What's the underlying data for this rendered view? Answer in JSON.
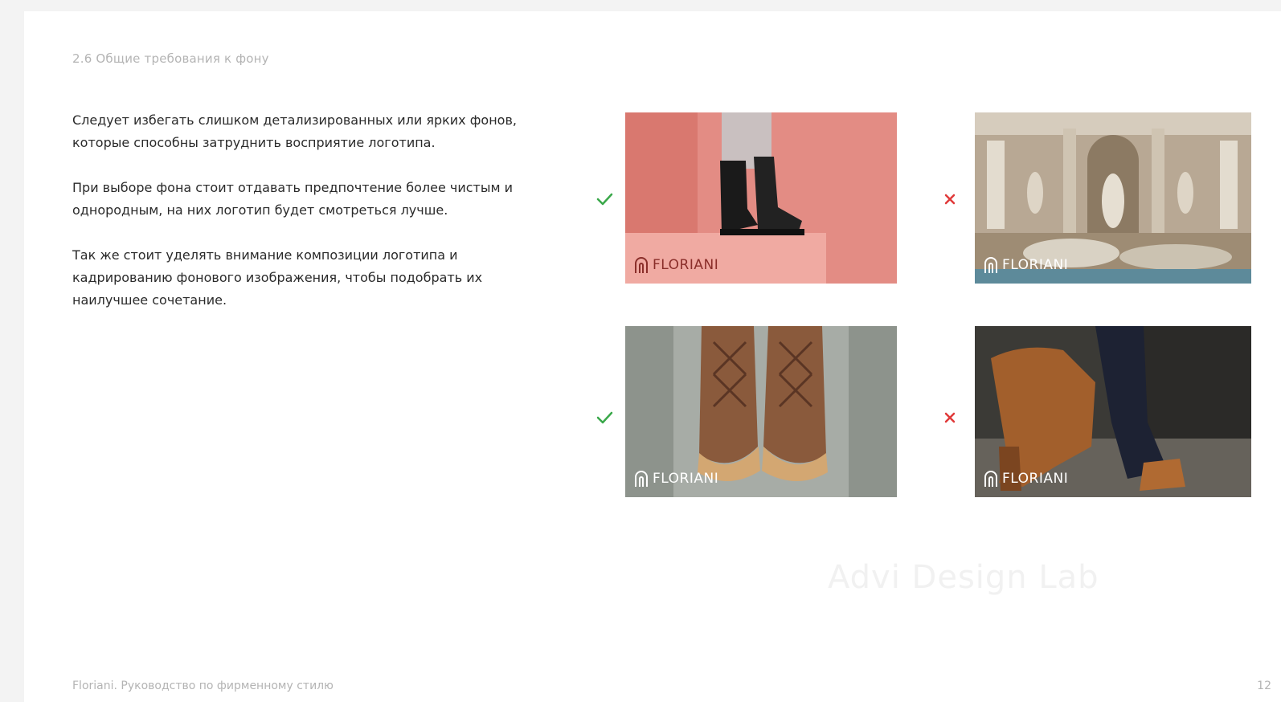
{
  "section_title": "2.6 Общие требования к фону",
  "paragraphs": [
    "Следует избегать слишком детализированных или ярких фонов, которые способны затруднить восприятие логотипа.",
    "При выборе фона стоит отдавать предпочтение более чистым и однородным, на них логотип будет смотреться лучше.",
    "Так же стоит уделять внимание композиции логотипа и кадрированию фонового изображения, чтобы подобрать их наилучшее сочетание."
  ],
  "examples": [
    {
      "status": "good",
      "brand": "FLORIANI"
    },
    {
      "status": "bad",
      "brand": "FLORIANI"
    },
    {
      "status": "good",
      "brand": "FLORIANI"
    },
    {
      "status": "bad",
      "brand": "FLORIANI"
    }
  ],
  "watermark": "Advi Design Lab",
  "footer": "Floriani. Руководство по фирменному стилю",
  "page_number": "12",
  "colors": {
    "good": "#3aa84a",
    "bad": "#e03a3a",
    "muted_text": "#b4b4b4",
    "body_text": "#2a2a2a"
  }
}
